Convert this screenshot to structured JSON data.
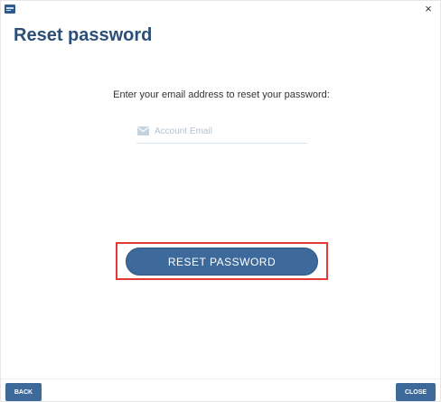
{
  "window": {
    "close_glyph": "×",
    "app_icon": "app-icon"
  },
  "page": {
    "title": "Reset password",
    "prompt": "Enter your email address to reset your password:"
  },
  "email": {
    "icon": "mail-icon",
    "placeholder": "Account Email",
    "value": ""
  },
  "actions": {
    "reset_label": "RESET PASSWORD"
  },
  "footer": {
    "back_label": "BACK",
    "close_label": "CLOSE"
  },
  "colors": {
    "title": "#2c4f78",
    "button": "#3e6a9b",
    "highlight": "#e53935"
  }
}
